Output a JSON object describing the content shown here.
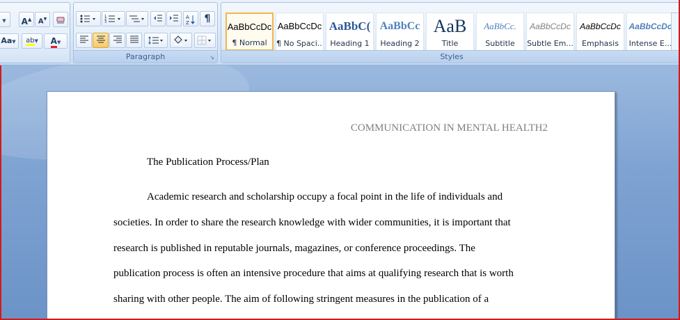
{
  "ribbon": {
    "font": {
      "change_case_label": "Aa",
      "grow_font_label": "A",
      "shrink_font_label": "A",
      "highlight_label": "ab",
      "font_color_label": "A",
      "font_color": "#e02020",
      "highlight_color": "#ffff00"
    },
    "paragraph": {
      "label": "Paragraph",
      "show_marks_label": "¶"
    },
    "styles": {
      "label": "Styles",
      "items": [
        {
          "sample": "AaBbCcDc",
          "name": "¶ Normal",
          "selected": true
        },
        {
          "sample": "AaBbCcDc",
          "name": "¶ No Spaci..."
        },
        {
          "sample": "AaBbC(",
          "name": "Heading 1"
        },
        {
          "sample": "AaBbCc",
          "name": "Heading 2"
        },
        {
          "sample": "AaB",
          "name": "Title"
        },
        {
          "sample": "AaBbCc.",
          "name": "Subtitle"
        },
        {
          "sample": "AaBbCcDc",
          "name": "Subtle Em..."
        },
        {
          "sample": "AaBbCcDc",
          "name": "Emphasis"
        },
        {
          "sample": "AaBbCcDc",
          "name": "Intense E..."
        }
      ]
    }
  },
  "document": {
    "header": "COMMUNICATION IN MENTAL HEALTH2",
    "title": "The Publication Process/Plan",
    "lines": [
      "Academic research and scholarship  occupy a  focal point in the life of individuals and",
      "societies. In order to share the research knowledge with wider communities,  it is important that",
      "research is published in reputable journals, magazines, or conference proceedings. The",
      "publication process  is  often an intensive procedure that aims at qualifying research that is worth",
      "sharing with other people. The aim of following stringent measures in the publication  of a"
    ]
  }
}
